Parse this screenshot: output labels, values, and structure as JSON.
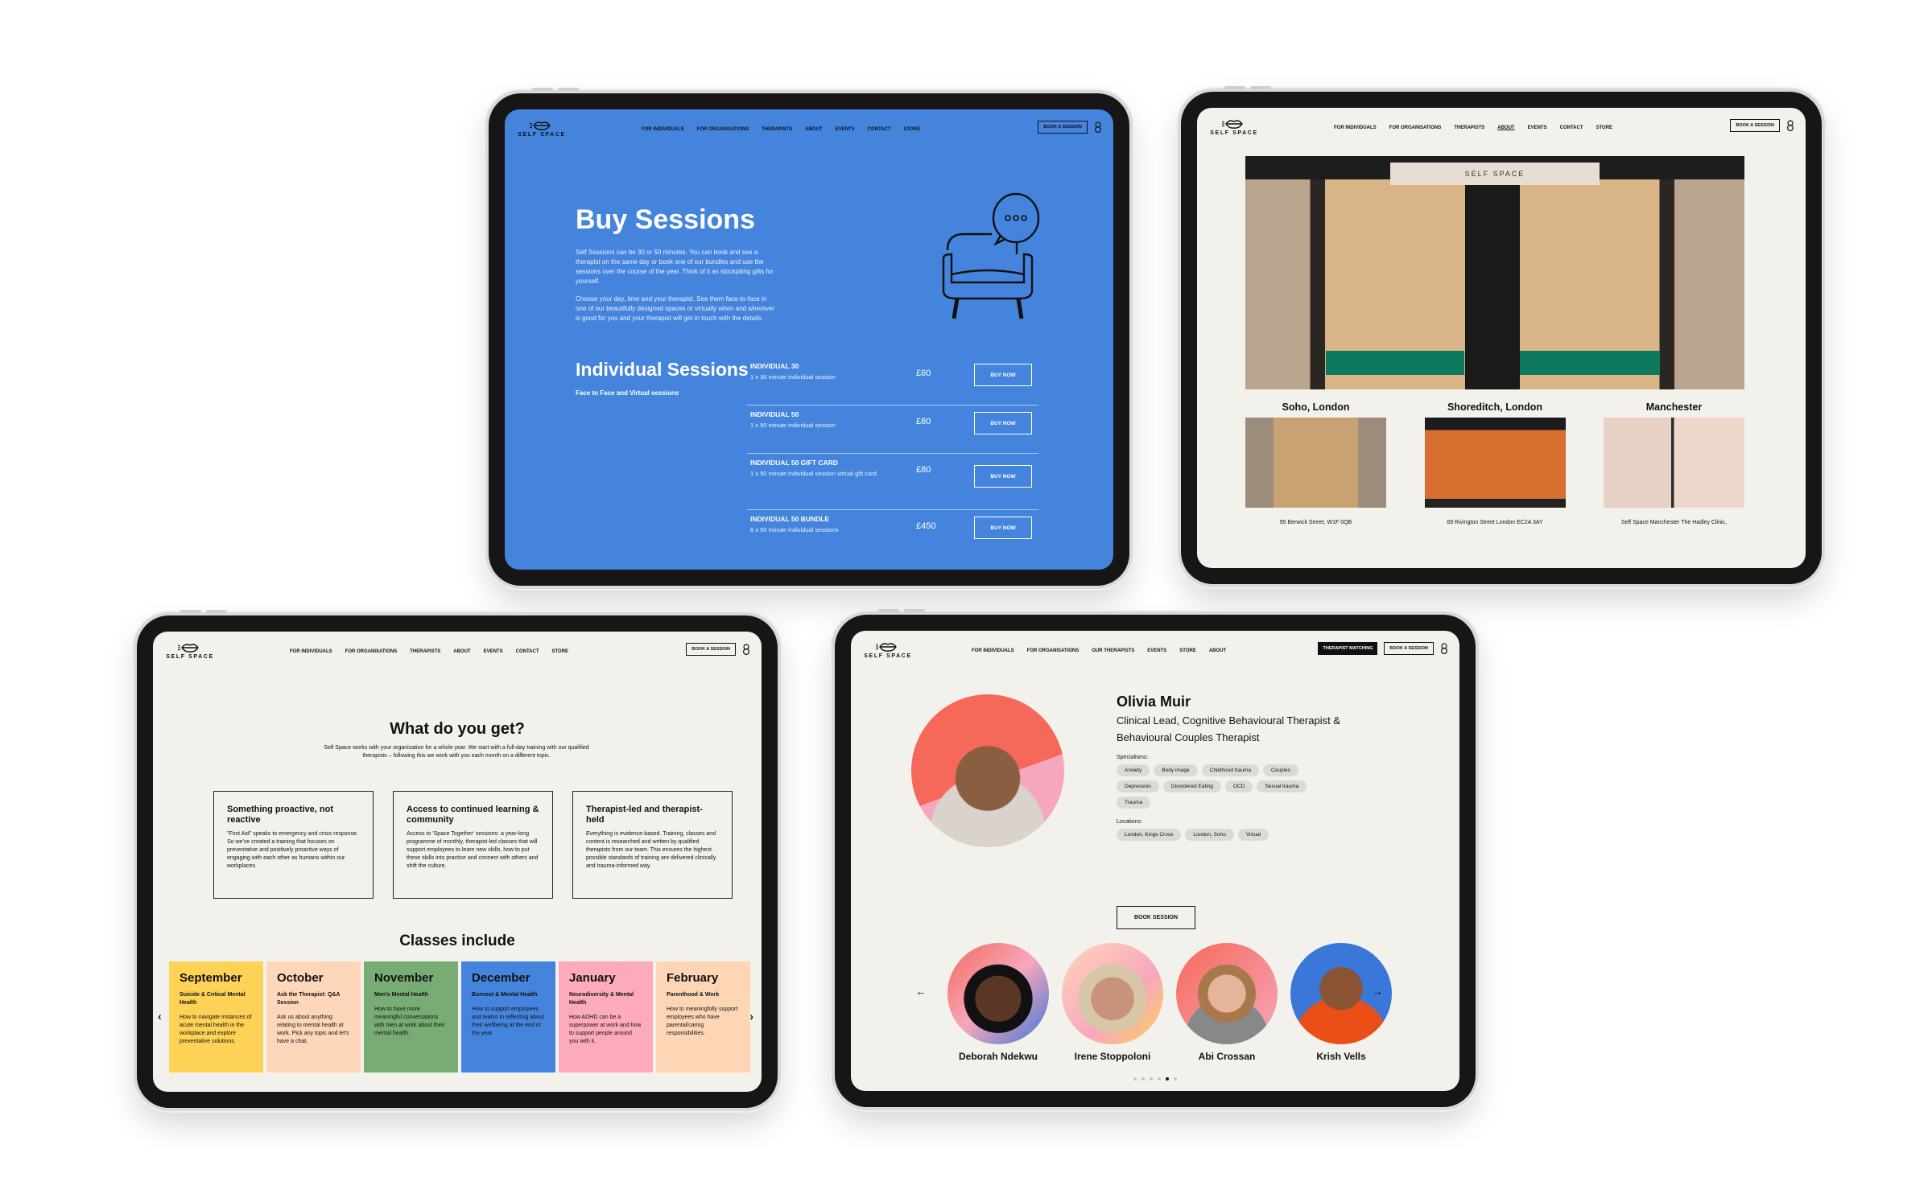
{
  "brand": {
    "name": "SELF SPACE"
  },
  "nav_common": {
    "for_individuals": "FOR INDIVIDUALS",
    "for_organisations": "FOR ORGANISATIONS",
    "therapists": "THERAPISTS",
    "about": "ABOUT",
    "events": "EVENTS",
    "contact": "CONTACT",
    "store": "STORE",
    "book_a_session": "BOOK A SESSION"
  },
  "nav_profile": {
    "for_individuals": "FOR INDIVIDUALS",
    "for_organisations": "FOR ORGANISATIONS",
    "our_therapists": "OUR THERAPISTS",
    "events": "EVENTS",
    "store": "STORE",
    "about": "ABOUT",
    "therapist_matching": "THERAPIST MATCHING",
    "book_a_session": "BOOK A SESSION"
  },
  "buy_sessions": {
    "title": "Buy Sessions",
    "paragraph1": "Self Sessions can be 30 or 50 minutes. You can book and see a therapist on the same day or book one of our bundles and use the sessions over the course of the year. Think of it as stockpiling gifts for yourself.",
    "paragraph2": "Choose your day, time and your therapist. See them face-to-face in one of our beautifully designed spaces or virtually when and wherever is good for you and your therapist will get in touch with the details.",
    "section_title": "Individual Sessions",
    "section_subtitle": "Face to Face and Virtual sessions",
    "buy_label": "BUY NOW",
    "packages": [
      {
        "name": "INDIVIDUAL 30",
        "desc": "1 x 30 minute individual session",
        "price": "£60"
      },
      {
        "name": "INDIVIDUAL 50",
        "desc": "1 x 50 minute individual session",
        "price": "£80"
      },
      {
        "name": "INDIVIDUAL 50 GIFT CARD",
        "desc": "1 x 50 minute individual session virtual gift card",
        "price": "£80"
      },
      {
        "name": "INDIVIDUAL 50 BUNDLE",
        "desc": "6 x 50 minute individual sessions",
        "price": "£450"
      }
    ]
  },
  "locations": {
    "store_sign": "SELF SPACE",
    "items": [
      {
        "name": "Soho, London",
        "address": "95 Berwick Street, W1F 0QB"
      },
      {
        "name": "Shoreditch, London",
        "address": "69 Rivington Street London EC2A 3AY"
      },
      {
        "name": "Manchester",
        "address": "Self Space Manchester The Hadley Clinic,"
      }
    ]
  },
  "organisations": {
    "title": "What do you get?",
    "subtitle": "Self Space works with your organisation for a whole year. We start with a full-day training with our qualified therapists – following this we work with you each month on a different topic.",
    "features": [
      {
        "title": "Something proactive, not reactive",
        "body": "\"First Aid\" speaks to emergency and crisis response. So we've created a training that focuses on preventative and positively proactive ways of engaging with each other as humans within our workplaces."
      },
      {
        "title": "Access to continued learning & community",
        "body": "Access to 'Space Together' sessions: a year-long programme of monthly, therapist-led classes that will support employees to learn new skills, how to put these skills into practice and connect with others and shift the culture."
      },
      {
        "title": "Therapist-led and therapist-held",
        "body": "Everything is evidence-based. Training, classes and content is researched and written by qualified therapists from our team. This ensures the highest possible standards of training are delivered clinically and trauma-informed way."
      }
    ],
    "classes_title": "Classes include",
    "months": [
      {
        "name": "September",
        "topic": "Suicide & Critical Mental Health",
        "body": "How to navigate instances of acute mental health in the workplace and explore preventative solutions.",
        "color": "#fdd257"
      },
      {
        "name": "October",
        "topic": "Ask the Therapist: Q&A Session",
        "body": "Ask us about anything relating to mental health at work. Pick any topic and let's have a chat.",
        "color": "#fed6b9"
      },
      {
        "name": "November",
        "topic": "Men's Mental Health",
        "body": "How to have more meaningful conversations with men at work about their mental health.",
        "color": "#77ac74"
      },
      {
        "name": "December",
        "topic": "Burnout & Mental Health",
        "body": "How to support employees and teams in reflecting about their wellbeing at the end of the year.",
        "color": "#4584dd"
      },
      {
        "name": "January",
        "topic": "Neurodiversity & Mental Health",
        "body": "How ADHD can be a superpower at work and how to support people around you with it.",
        "color": "#fdaabd"
      },
      {
        "name": "February",
        "topic": "Parenthood & Work",
        "body": "How to meaningfully support employees who have parental/caring responsibilities.",
        "color": "#fed6b5"
      }
    ]
  },
  "therapist": {
    "name": "Olivia Muir",
    "role": "Clinical Lead, Cognitive Behavioural Therapist & Behavioural Couples Therapist",
    "specialisms_label": "Specialisms:",
    "specialisms": [
      "Anxiety",
      "Body image",
      "Childhood trauma",
      "Couples",
      "Depression",
      "Disordered Eating",
      "OCD",
      "Sexual trauma",
      "Trauma"
    ],
    "locations_label": "Locations:",
    "locations": [
      "London, Kings Cross",
      "London, Soho",
      "Virtual"
    ],
    "book_label": "BOOK SESSION",
    "team": [
      "Deborah Ndekwu",
      "Irene Stoppoloni",
      "Abi Crossan",
      "Krish Vells"
    ],
    "carousel": {
      "total_pages": 6,
      "active_page": 5
    }
  }
}
